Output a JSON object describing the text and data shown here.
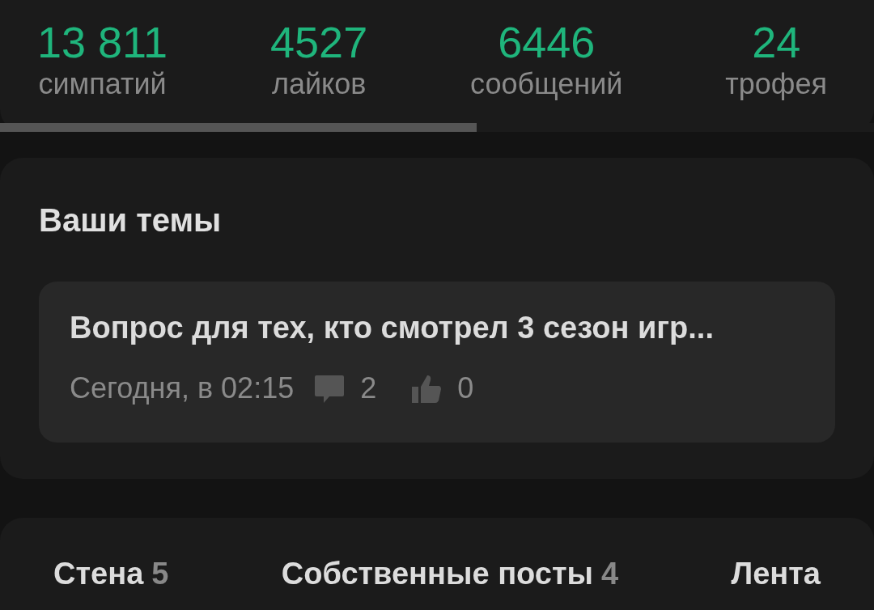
{
  "stats": [
    {
      "value": "13 811",
      "label": "симпатий"
    },
    {
      "value": "4527",
      "label": "лайков"
    },
    {
      "value": "6446",
      "label": "сообщений"
    },
    {
      "value": "24",
      "label": "трофея"
    }
  ],
  "progress": {
    "level": 0.545
  },
  "topics": {
    "title": "Ваши темы",
    "items": [
      {
        "title": "Вопрос для тех, кто смотрел 3 сезон игр...",
        "time": "Сегодня, в 02:15",
        "comments": "2",
        "likes": "0"
      }
    ]
  },
  "tabs": [
    {
      "label": "Стена",
      "count": "5"
    },
    {
      "label": "Собственные посты",
      "count": "4"
    },
    {
      "label": "Лента"
    }
  ]
}
